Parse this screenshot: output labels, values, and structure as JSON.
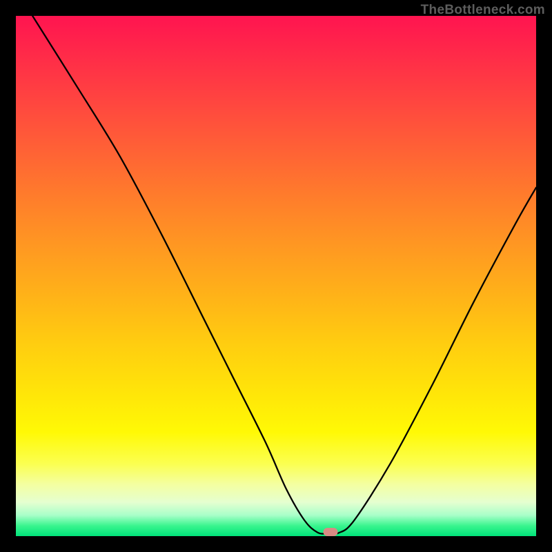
{
  "watermark": "TheBottleneck.com",
  "chart_data": {
    "type": "line",
    "title": "",
    "xlabel": "",
    "ylabel": "",
    "xlim": [
      0,
      100
    ],
    "ylim": [
      0,
      100
    ],
    "curve": {
      "x": [
        3.2,
        12,
        20,
        28,
        36,
        42,
        48,
        52,
        55.5,
        58,
        60,
        62,
        65,
        72,
        80,
        88,
        96,
        100
      ],
      "y": [
        100,
        86,
        73,
        58,
        42,
        30,
        18,
        9,
        3,
        0.7,
        0.5,
        0.6,
        3,
        14,
        29,
        45,
        60,
        67
      ]
    },
    "marker": {
      "x": 60.5,
      "y": 0.8,
      "color": "#d98a84"
    }
  }
}
